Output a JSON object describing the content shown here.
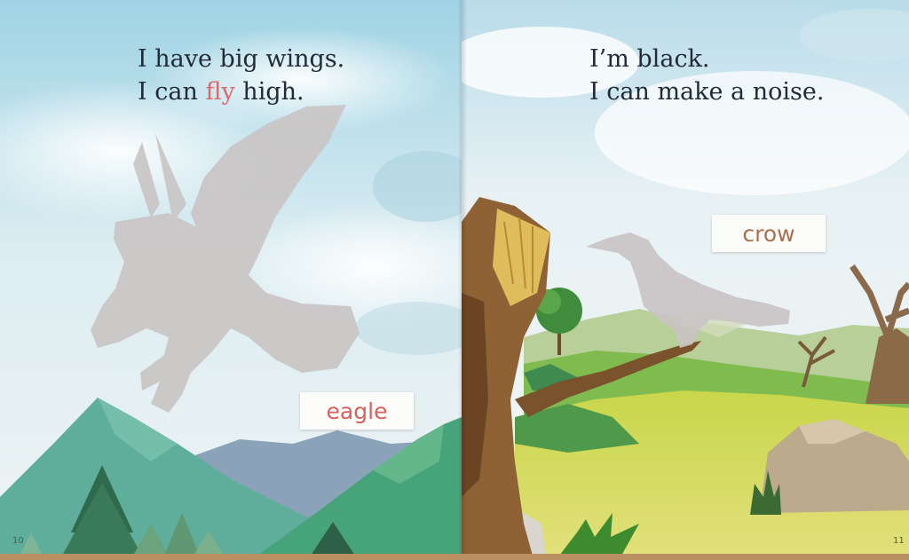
{
  "left_page": {
    "text_line_1": "I have big wings.",
    "text_line_2_before": "I can ",
    "text_line_2_highlight": "fly",
    "text_line_2_after": " high.",
    "label": "eagle",
    "page_number": "10",
    "highlight_color": "#e0686b",
    "label_color": "#d9605f"
  },
  "right_page": {
    "text_line_1": "I’m black.",
    "text_line_2": "I can make a noise.",
    "label": "crow",
    "page_number": "11",
    "label_color": "#a9714e"
  },
  "colors": {
    "text": "#222b38",
    "silhouette": "#c9c4c4"
  }
}
